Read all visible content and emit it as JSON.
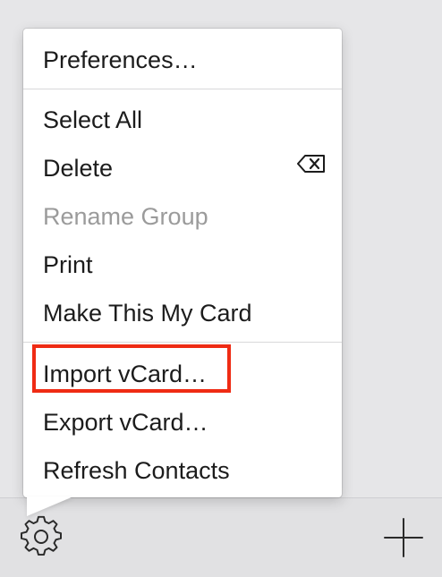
{
  "menu": {
    "items": [
      {
        "label": "Preferences…",
        "enabled": true
      },
      {
        "label": "Select All",
        "enabled": true
      },
      {
        "label": "Delete",
        "enabled": true,
        "shortcut_icon": "delete-key-icon"
      },
      {
        "label": "Rename Group",
        "enabled": false
      },
      {
        "label": "Print",
        "enabled": true
      },
      {
        "label": "Make This My Card",
        "enabled": true
      },
      {
        "label": "Import vCard…",
        "enabled": true,
        "highlighted": true
      },
      {
        "label": "Export vCard…",
        "enabled": true
      },
      {
        "label": "Refresh Contacts",
        "enabled": true
      }
    ]
  },
  "toolbar": {
    "gear_icon": "gear-icon",
    "add_icon": "plus-icon"
  },
  "colors": {
    "highlight": "#ef2b14",
    "disabled_text": "#9b9b9b",
    "text": "#1c1c1c"
  }
}
